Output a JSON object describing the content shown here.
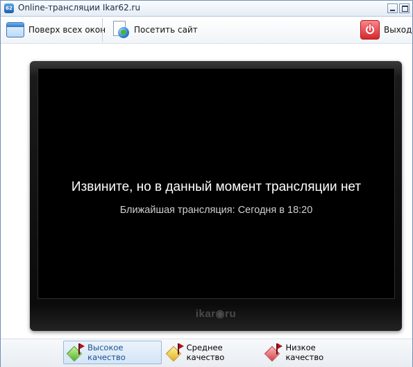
{
  "window": {
    "app_icon_text": "62",
    "title": "Online-трансляции Ikar62.ru"
  },
  "toolbar": {
    "on_top_label": "Поверх всех окон",
    "visit_site_label": "Посетить сайт",
    "exit_label": "Выход"
  },
  "player": {
    "message": "Извините, но в данный момент трансляции нет",
    "next_broadcast": "Ближайшая трансляция: Сегодня в 18:20",
    "brand": "ikar◉ru"
  },
  "quality": {
    "high_label": "Высокое качество",
    "medium_label": "Среднее качество",
    "low_label": "Низкое качество",
    "selected": "high"
  },
  "colors": {
    "screen_bg": "#000000",
    "accent_exit": "#d6262c",
    "active_label": "#1d4f8f"
  }
}
